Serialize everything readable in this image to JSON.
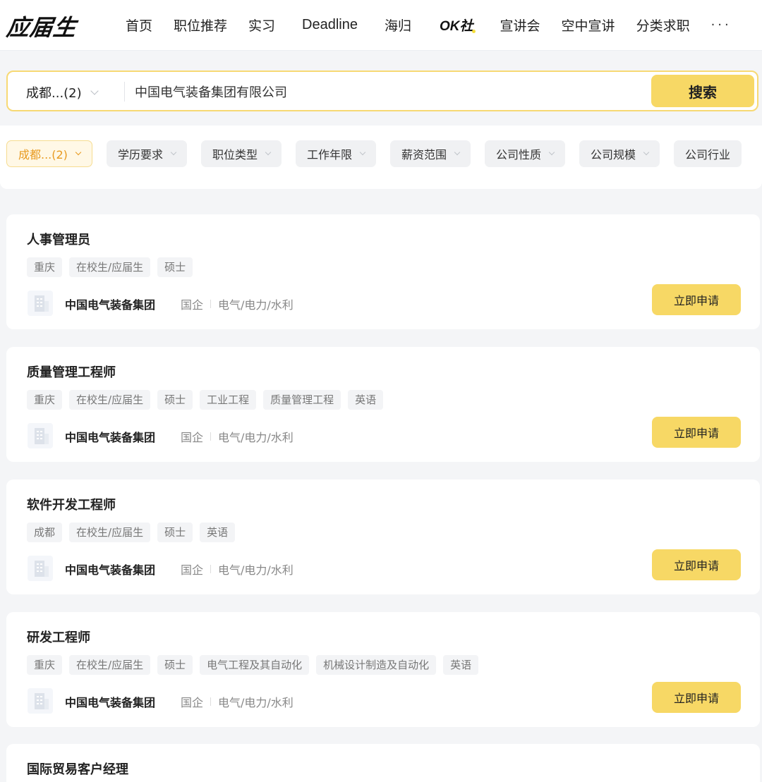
{
  "header": {
    "logo": "应届生",
    "nav": [
      "首页",
      "职位推荐",
      "实习",
      "Deadline",
      "海归",
      "OK社",
      "宣讲会",
      "空中宣讲",
      "分类求职"
    ],
    "more": "···"
  },
  "search": {
    "city": "成都...(2)",
    "value": "中国电气装备集团有限公司",
    "button": "搜索"
  },
  "filters": [
    "成都...(2)",
    "学历要求",
    "职位类型",
    "工作年限",
    "薪资范围",
    "公司性质",
    "公司规模",
    "公司行业"
  ],
  "jobs": [
    {
      "title": "人事管理员",
      "tags": [
        "重庆",
        "在校生/应届生",
        "硕士"
      ],
      "company": "中国电气装备集团",
      "company_type": "国企",
      "industry": "电气/电力/水利",
      "apply": "立即申请"
    },
    {
      "title": "质量管理工程师",
      "tags": [
        "重庆",
        "在校生/应届生",
        "硕士",
        "工业工程",
        "质量管理工程",
        "英语"
      ],
      "company": "中国电气装备集团",
      "company_type": "国企",
      "industry": "电气/电力/水利",
      "apply": "立即申请"
    },
    {
      "title": "软件开发工程师",
      "tags": [
        "成都",
        "在校生/应届生",
        "硕士",
        "英语"
      ],
      "company": "中国电气装备集团",
      "company_type": "国企",
      "industry": "电气/电力/水利",
      "apply": "立即申请"
    },
    {
      "title": "研发工程师",
      "tags": [
        "重庆",
        "在校生/应届生",
        "硕士",
        "电气工程及其自动化",
        "机械设计制造及自动化",
        "英语"
      ],
      "company": "中国电气装备集团",
      "company_type": "国企",
      "industry": "电气/电力/水利",
      "apply": "立即申请"
    },
    {
      "title": "国际贸易客户经理"
    }
  ],
  "colors": {
    "accent": "#f7d865",
    "search_border": "#f7d974",
    "filter_active_text": "#e89a1f",
    "background": "#f4f5f7"
  },
  "icons": {
    "company_logo": "building-icon",
    "dropdown": "chevron-down-icon"
  }
}
